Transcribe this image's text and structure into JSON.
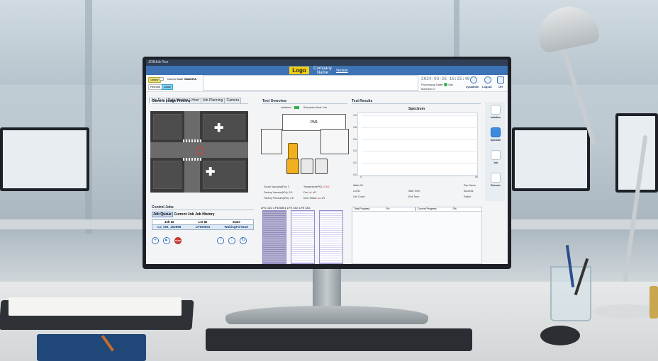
{
  "window": {
    "title": "JOBJob Run"
  },
  "header": {
    "logo": "Logo",
    "company_line1": "Company",
    "company_line2": "Name",
    "version": "Version"
  },
  "status": {
    "online": "Online",
    "comm_label": "Comm State",
    "comm_value": "WaitCRA",
    "remote": "Remote",
    "local": "Local",
    "datetime": "2024-03-26  16:25:48",
    "processing_label": "Processing State",
    "processing_value": "Idle",
    "machine_label": "Machine Id"
  },
  "toolbar": {
    "user": "sysadmin",
    "logout": "Logout",
    "off": "Off"
  },
  "tabs": [
    "Job Run",
    "Data Monitor",
    "Host",
    "Job Planning",
    "Camera"
  ],
  "camera": {
    "title": "Camera Image Preview"
  },
  "tool_overview": {
    "title": "Tool Overview",
    "initialized": "Initialized",
    "scheduler_label": "Scheduler Mode:",
    "scheduler_value": "Job",
    "pm_label": "PM1",
    "chuck_vacuum": "Chuck Vacuum(kPa):",
    "chuck_vacuum_value": "0",
    "temperature": "Temperature(℃):",
    "temperature_value": "0.002",
    "factory_vacuum": "Factory Vacuum(kPa):",
    "factory_vacuum_value": "3.8",
    "fan": "Fan:",
    "fan_l": "L",
    "fan_r": "R",
    "factory_pressure": "Factory Pressure(kPa):",
    "factory_pressure_value": "3.8",
    "door_status": "Door Status:",
    "door_l": "L",
    "door_r": "R"
  },
  "test_results": {
    "title": "Test Results",
    "chart_title": "Spectrum",
    "wafer_id": "Wafer ID:",
    "rcp_name": "Rcp Name:",
    "lot_id": "Lot ID:",
    "start_time": "Start Time:",
    "success": "Success:",
    "cell_count": "Cell Count:",
    "end_time": "End Time:",
    "failed": "Failed:"
  },
  "chart_data": {
    "type": "line",
    "title": "Spectrum",
    "xlabel": "",
    "ylabel": "",
    "xlim": [
      0,
      40
    ],
    "ylim": [
      0,
      1
    ],
    "yticks": [
      "1.0",
      "0.8",
      "0.6",
      "0.4",
      "0.2",
      "0.0"
    ],
    "xticks": [
      "0",
      "40"
    ],
    "series": []
  },
  "right_menu": [
    {
      "label": "Initialize",
      "icon": "initialize-icon"
    },
    {
      "label": "Operator",
      "icon": "hand-icon"
    },
    {
      "label": "Job",
      "icon": "job-icon"
    },
    {
      "label": "Recover",
      "icon": "recover-icon"
    }
  ],
  "control_jobs": {
    "title": "Control Jobs",
    "tabs": [
      "Job Queue",
      "Current Job",
      "Job History"
    ],
    "columns": [
      "Job ID",
      "Lot ID",
      "State"
    ],
    "rows": [
      {
        "job_id": "CJ_001_152858",
        "lot_id": "LP100001",
        "state": "WaitingForStart"
      }
    ],
    "stop": "STOP"
  },
  "loadports": {
    "lp1": "LP1",
    "cid1": "CID: LP100001",
    "lp2": "LP2",
    "cid2": "CID:",
    "lp3": "LP3",
    "cid3": "CID:"
  },
  "progress": {
    "total_label": "Total Progress",
    "total_value": "0%",
    "current_label": "Current Progress",
    "current_value": "0%"
  }
}
